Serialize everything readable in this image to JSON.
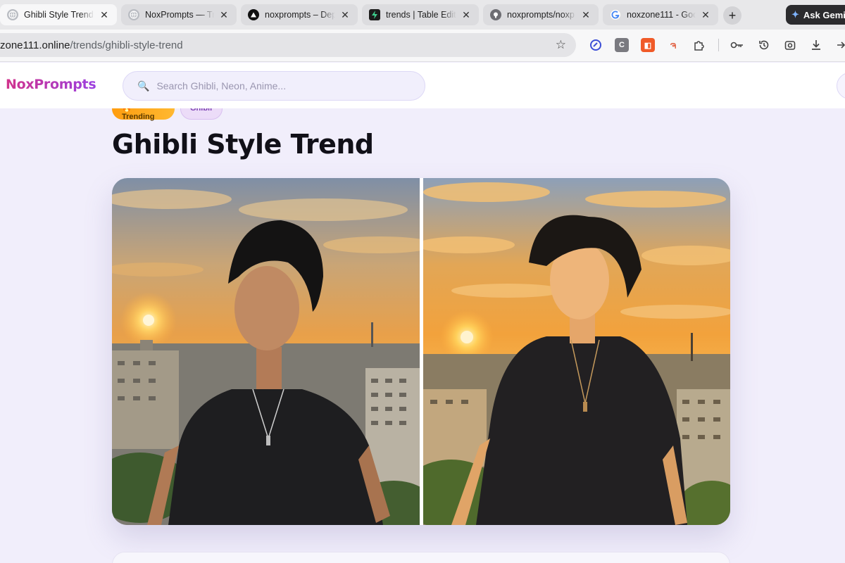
{
  "browser": {
    "tabs": [
      {
        "title": "Ghibli Style Trend",
        "favicon": "globe-icon",
        "active": true
      },
      {
        "title": "NoxPrompts — Tr",
        "favicon": "globe-icon",
        "active": false
      },
      {
        "title": "noxprompts – Dep",
        "favicon": "vercel-icon",
        "active": false
      },
      {
        "title": "trends | Table Edit",
        "favicon": "supabase-icon",
        "active": false
      },
      {
        "title": "noxprompts/noxp",
        "favicon": "github-icon",
        "active": false
      },
      {
        "title": "noxzone111 - Goo",
        "favicon": "google-icon",
        "active": false
      }
    ],
    "close_glyph": "✕",
    "new_tab_glyph": "+",
    "ask_gemini_label": "Ask Gemi",
    "url_host": "zone111.online",
    "url_path": "/trends/ghibli-style-trend"
  },
  "site": {
    "logo": "NoxPrompts",
    "search_placeholder": "Search Ghibli, Neon, Anime..."
  },
  "trend": {
    "badge_trending": "🔥 Trending",
    "badge_tag": "Ghibli",
    "title": "Ghibli Style Trend",
    "before_image": "photo-man-black-tshirt-sunset-city",
    "after_image": "ghibli-anime-man-black-tshirt-sunset-city"
  }
}
